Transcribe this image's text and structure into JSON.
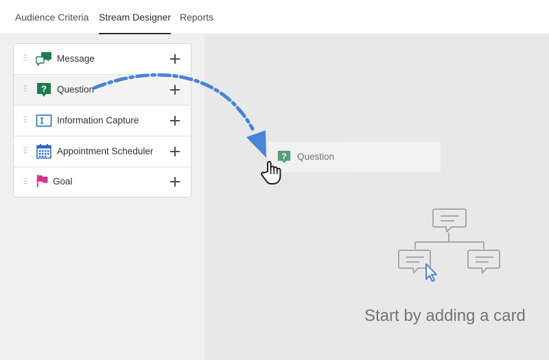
{
  "tabs": [
    {
      "label": "Audience Criteria",
      "active": false
    },
    {
      "label": "Stream Designer",
      "active": true
    },
    {
      "label": "Reports",
      "active": false
    }
  ],
  "cards": [
    {
      "label": "Message",
      "icon": "message-icon",
      "color": "#1c7a50"
    },
    {
      "label": "Question",
      "icon": "question-icon",
      "color": "#1c7a50"
    },
    {
      "label": "Information Capture",
      "icon": "text-input-icon",
      "color": "#2a6ac7"
    },
    {
      "label": "Appointment Scheduler",
      "icon": "calendar-icon",
      "color": "#2a6ac7"
    },
    {
      "label": "Goal",
      "icon": "flag-icon",
      "color": "#d0318a"
    }
  ],
  "drag_preview": {
    "label": "Question",
    "icon": "question-icon"
  },
  "empty_state": {
    "text": "Start by adding a card",
    "icon": "card-tree-icon"
  },
  "colors": {
    "accent_blue": "#4a84d6",
    "brand_green": "#1c7a50",
    "goal_pink": "#d0318a"
  }
}
